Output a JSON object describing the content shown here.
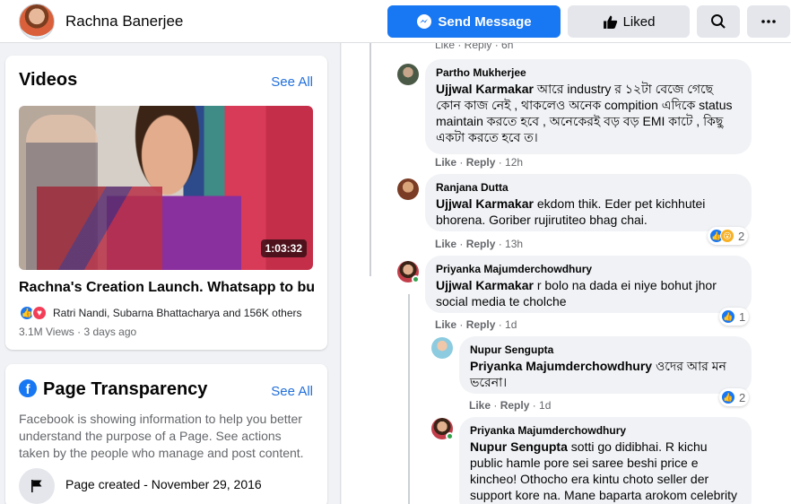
{
  "header": {
    "page_name": "Rachna Banerjee",
    "send_message_label": "Send Message",
    "liked_label": "Liked"
  },
  "videos": {
    "title": "Videos",
    "see_all": "See All",
    "duration": "1:03:32",
    "video_title": "Rachna's Creation Launch. Whatsapp to bu...",
    "reactions_text": "Ratri Nandi, Subarna Bhattacharya and 156K others",
    "meta": "3.1M Views · 3 days ago"
  },
  "transparency": {
    "title": "Page Transparency",
    "see_all": "See All",
    "description": "Facebook is showing information to help you better understand the purpose of a Page. See actions taken by the people who manage and post content.",
    "page_created": "Page created - November 29, 2016"
  },
  "comments": [
    {
      "author": "Partho Mukherjee",
      "mention": "Ujjwal Karmakar",
      "text": " আরে industry র ১২টা বেজে গেছে কোন কাজ নেই , থাকলেও অনেক compition এদিকে status maintain করতে হবে , অনেকেরই বড় বড় EMI কাটে , কিছু একটা করতে হবে ত।",
      "like": "Like",
      "reply": "Reply",
      "time": "12h"
    },
    {
      "author": "Ranjana Dutta",
      "mention": "Ujjwal Karmakar",
      "text": " ekdom thik. Eder pet kichhutei bhorena. Goriber rujirutiteo bhag chai.",
      "like": "Like",
      "reply": "Reply",
      "time": "13h",
      "reaction_count": "2"
    },
    {
      "author": "Priyanka Majumderchowdhury",
      "mention": "Ujjwal Karmakar",
      "text": " r bolo na dada ei niye bohut jhor social media te cholche",
      "like": "Like",
      "reply": "Reply",
      "time": "1d",
      "reaction_count": "1"
    },
    {
      "author": "Nupur Sengupta",
      "mention": "Priyanka Majumderchowdhury",
      "text": " ওদের আর মন ভরেনা।",
      "like": "Like",
      "reply": "Reply",
      "time": "1d",
      "reaction_count": "2"
    },
    {
      "author": "Priyanka Majumderchowdhury",
      "mention": "Nupur Sengupta",
      "text": " sotti go didibhai. R kichu public hamle pore sei saree beshi price e kincheo! Othocho era kintu choto seller der support kore na. Mane baparta arokom celebrity der theke"
    }
  ],
  "top_partial_actions": "Like · Reply · 6h",
  "colors": {
    "accent": "#1877f2",
    "like_reaction": "#1877f2",
    "love_reaction": "#f33e58",
    "wow_reaction": "#f7b125"
  }
}
